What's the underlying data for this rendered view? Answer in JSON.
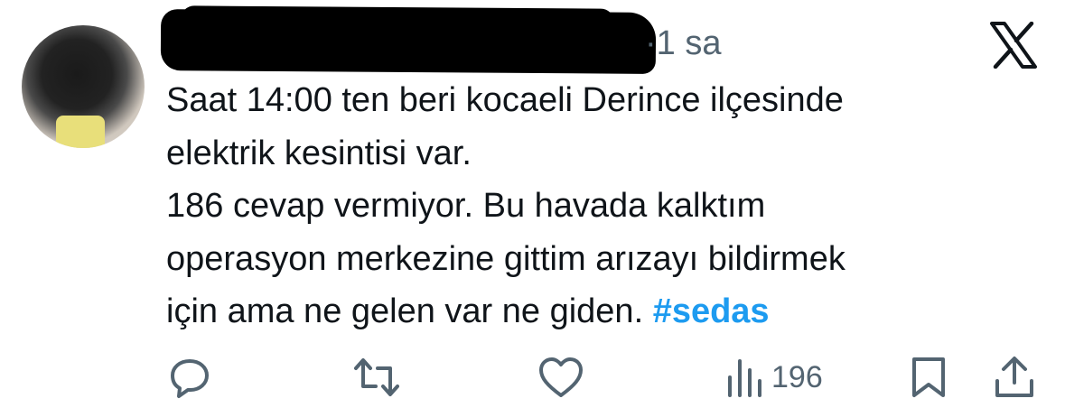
{
  "tweet": {
    "time": "1 sa",
    "time_separator": "·",
    "text_lines": [
      "Saat 14:00 ten beri kocaeli Derince ilçesinde",
      "elektrik kesintisi var.",
      "186 cevap vermiyor. Bu havada kalktım",
      "operasyon merkezine gittim arızayı bildirmek",
      "için ama ne gelen var ne giden."
    ],
    "hashtag": "#sedas"
  },
  "actions": {
    "reply_icon": "reply-icon",
    "retweet_icon": "retweet-icon",
    "like_icon": "heart-icon",
    "views_icon": "views-icon",
    "views_count": "196",
    "bookmark_icon": "bookmark-icon",
    "share_icon": "share-icon"
  },
  "brand": {
    "logo": "x-logo-icon"
  },
  "colors": {
    "text": "#0f1419",
    "secondary": "#536471",
    "link": "#1d9bf0",
    "background": "#ffffff"
  }
}
